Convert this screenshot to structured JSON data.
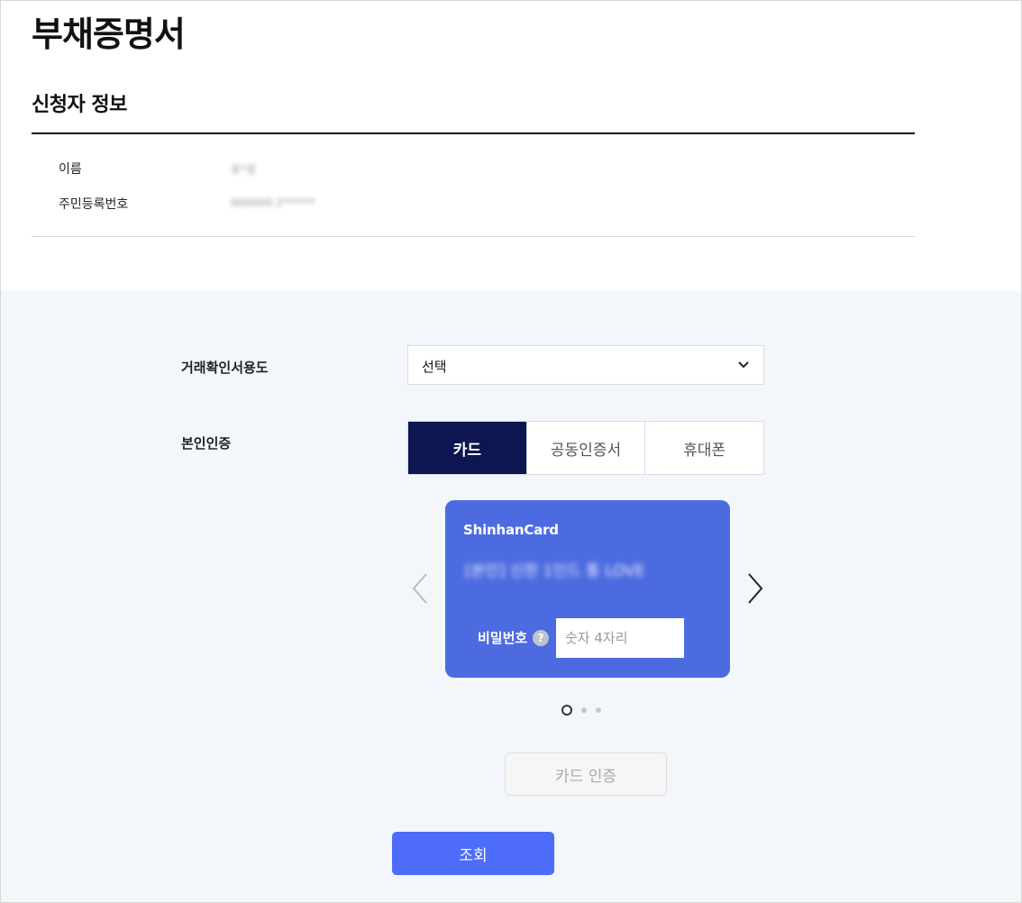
{
  "page": {
    "title": "부채증명서",
    "section_title": "신청자 정보"
  },
  "applicant": {
    "name_label": "이름",
    "name_value": "유*정",
    "rrn_label": "주민등록번호",
    "rrn_value": "000000-2******"
  },
  "form": {
    "purpose_label": "거래확인서용도",
    "purpose_selected": "선택",
    "auth_label": "본인인증",
    "auth_tabs": [
      {
        "label": "카드",
        "active": true
      },
      {
        "label": "공동인증서",
        "active": false
      },
      {
        "label": "휴대폰",
        "active": false
      }
    ]
  },
  "card": {
    "brand": "ShinhanCard",
    "name": "[본인] 신한 1인드 통 LOVE",
    "password_label": "비밀번호",
    "help_icon": "question-icon",
    "password_placeholder": "숫자 4자리",
    "color": "#4d6be0"
  },
  "carousel": {
    "slides_total": 3,
    "active_index": 0
  },
  "buttons": {
    "verify_label": "카드 인증",
    "submit_label": "조회"
  },
  "colors": {
    "active_tab": "#0d1650",
    "submit": "#4c6cf9",
    "background_panel": "#f3f6fa"
  }
}
